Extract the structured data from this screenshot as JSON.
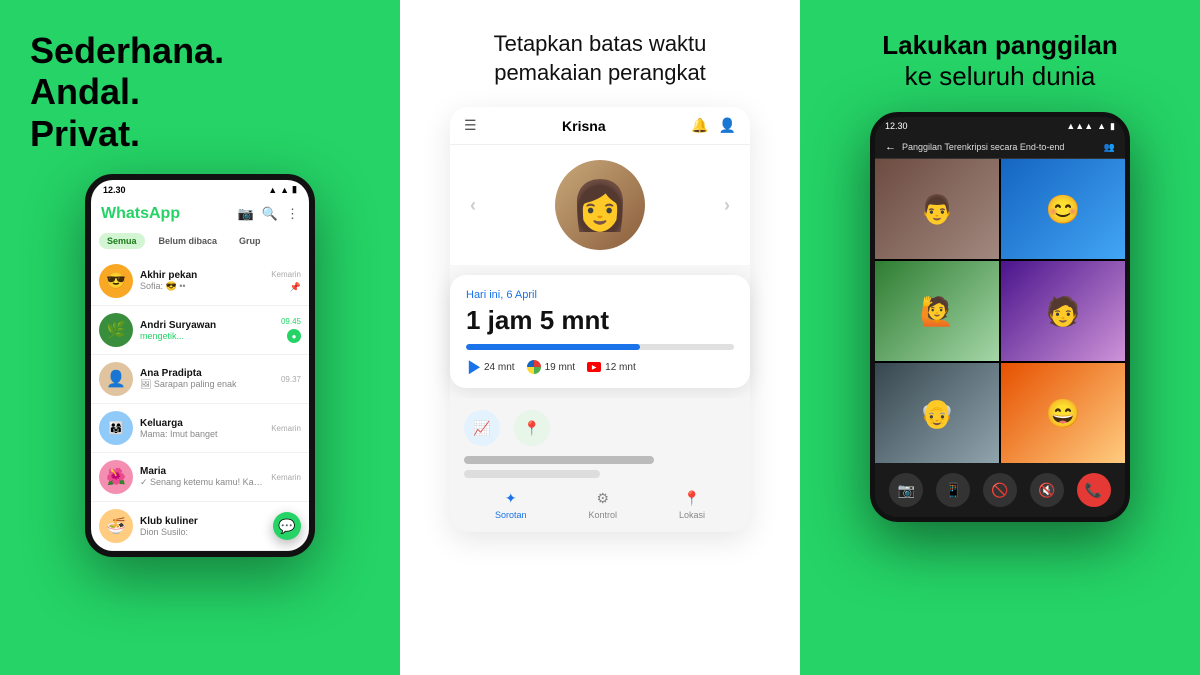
{
  "panels": {
    "left": {
      "headline": "Sederhana.\nAndal.\nPrivat.",
      "phone": {
        "statusTime": "12.30",
        "appName": "WhatsApp",
        "tabs": [
          "Semua",
          "Belum dibaca",
          "Grup"
        ],
        "activeTab": "Semua",
        "chats": [
          {
            "name": "Akhir pekan",
            "preview": "Sofia: 😎 ••",
            "time": "Kemarin",
            "pin": true,
            "badge": false,
            "avatar": "😎",
            "avatarBg": "#f9a825"
          },
          {
            "name": "Andri Suryawan",
            "preview": "mengetik...",
            "time": "09.45",
            "typing": true,
            "badge": true,
            "badgeCount": "",
            "avatar": "🌿",
            "avatarBg": "#388e3c"
          },
          {
            "name": "Ana Pradipta",
            "preview": "🖼 Sarapan paling enak",
            "time": "09.37",
            "badge": false,
            "avatar": "👤",
            "avatarBg": "#e0c4a0"
          },
          {
            "name": "Keluarga",
            "preview": "Mama: Imut banget",
            "time": "Kemarin",
            "badge": false,
            "avatar": "👨‍👩‍👧",
            "avatarBg": "#90caf9"
          },
          {
            "name": "Maria",
            "preview": "✓ Senang ketemu kamu! Kabari...",
            "time": "Kemarin",
            "badge": false,
            "avatar": "🌺",
            "avatarBg": "#f48fb1"
          },
          {
            "name": "Klub kuliner",
            "preview": "Dion Susilo:",
            "time": "",
            "badge": false,
            "avatar": "🍜",
            "avatarBg": "#ffcc80"
          }
        ]
      }
    },
    "center": {
      "title": "Tetapkan batas waktu\npemakaian perangkat",
      "profile": {
        "name": "Krisna",
        "emoji": "👩"
      },
      "screenTime": {
        "date": "Hari ini, 6 April",
        "total": "1 jam 5 mnt",
        "apps": [
          {
            "name": "24 mnt",
            "type": "play"
          },
          {
            "name": "19 mnt",
            "type": "chrome"
          },
          {
            "name": "12 mnt",
            "type": "youtube"
          }
        ]
      },
      "bottomNav": [
        {
          "label": "Sorotan",
          "icon": "✦",
          "active": true
        },
        {
          "label": "Kontrol",
          "icon": "⚙"
        },
        {
          "label": "Lokasi",
          "icon": "📍"
        }
      ]
    },
    "right": {
      "headline": "Lakukan panggilan",
      "headline2": "ke seluruh dunia",
      "phone": {
        "statusTime": "12.30",
        "callTitle": "Panggilan Terenkripsi secara End-to-end",
        "participants": [
          {
            "emoji": "👨",
            "bg": "vc1"
          },
          {
            "emoji": "😊",
            "bg": "vc2"
          },
          {
            "emoji": "👩",
            "bg": "vc3"
          },
          {
            "emoji": "👨‍💼",
            "bg": "vc4"
          },
          {
            "emoji": "👴👵",
            "bg": "vc5"
          },
          {
            "emoji": "😄",
            "bg": "vc6"
          }
        ],
        "controls": [
          "📷",
          "📱",
          "📷",
          "🔇",
          "📞"
        ]
      }
    }
  }
}
